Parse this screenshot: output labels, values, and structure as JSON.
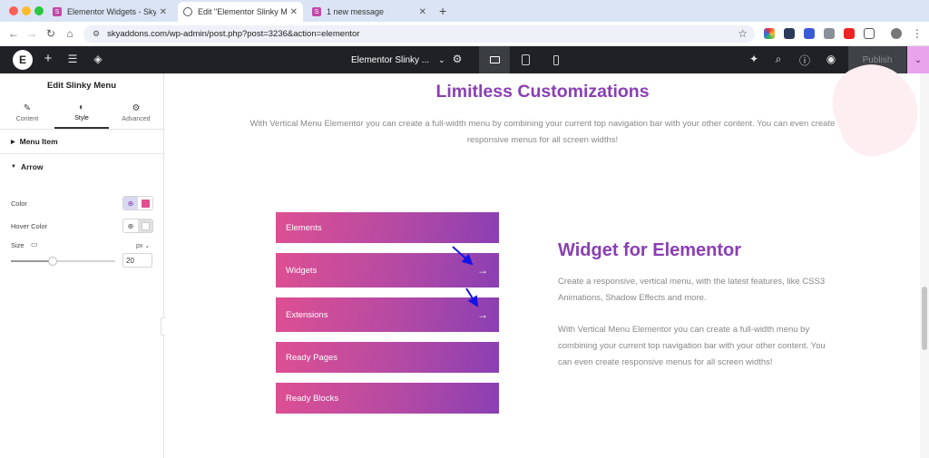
{
  "browser": {
    "tabs": [
      {
        "title": "Elementor Widgets - Sky Add",
        "favicon": "sky-addons-icon",
        "active": false
      },
      {
        "title": "Edit \"Elementor Slinky Menu",
        "favicon": "globe-icon",
        "active": true
      },
      {
        "title": "1 new message",
        "favicon": "sky-addons-icon",
        "active": false
      }
    ],
    "close_glyph": "✕",
    "new_tab_glyph": "+",
    "url": "skyaddons.com/wp-admin/post.php?post=3236&action=elementor"
  },
  "elementor_bar": {
    "logo": "E",
    "document_title": "Elementor Slinky ...",
    "publish_label": "Publish",
    "icons": [
      "plus-icon",
      "settings-sliders-icon",
      "layers-icon",
      "gear-icon",
      "desktop-icon",
      "tablet-icon",
      "mobile-icon",
      "notification-icon",
      "search-icon",
      "help-icon",
      "preview-eye-icon",
      "chevron-down-icon"
    ]
  },
  "panel": {
    "title": "Edit Slinky Menu",
    "tabs": [
      {
        "label": "Content",
        "icon": "pencil-icon"
      },
      {
        "label": "Style",
        "icon": "contrast-icon",
        "active": true
      },
      {
        "label": "Advanced",
        "icon": "gear-icon"
      }
    ],
    "sections": {
      "menu_item": "Menu Item",
      "arrow": "Arrow"
    },
    "controls": {
      "color_label": "Color",
      "hover_color_label": "Hover Color",
      "size_label": "Size",
      "size_unit": "px",
      "size_value": "20",
      "color_value": "#e0508f",
      "hover_color_value": "#ffffff",
      "slider_fraction": 0.4
    }
  },
  "canvas": {
    "heading": "Limitless Customizations",
    "intro": "With Vertical Menu Elementor you can create a full-width menu by combining your current top navigation bar with your other content. You can even create responsive menus for all screen widths!",
    "menu_items": [
      {
        "label": "Elements",
        "arrow": ""
      },
      {
        "label": "Widgets",
        "arrow": "→"
      },
      {
        "label": "Extensions",
        "arrow": "→"
      },
      {
        "label": "Ready Pages",
        "arrow": ""
      },
      {
        "label": "Ready Blocks",
        "arrow": ""
      }
    ],
    "widget_title": "Widget for Elementor",
    "paragraph_1": "Create a responsive, vertical menu, with the latest features, like CSS3 Animations, Shadow Effects and more.",
    "paragraph_2": "With Vertical Menu Elementor you can create a full-width menu by combining your current top navigation bar with your other content. You can even create responsive menus for all screen widths!"
  },
  "colors": {
    "brand_purple": "#8a3fb3",
    "menu_gradient_start": "#de4f92",
    "menu_gradient_end": "#8a3fb3",
    "annotation_arrow": "#1414e6"
  }
}
